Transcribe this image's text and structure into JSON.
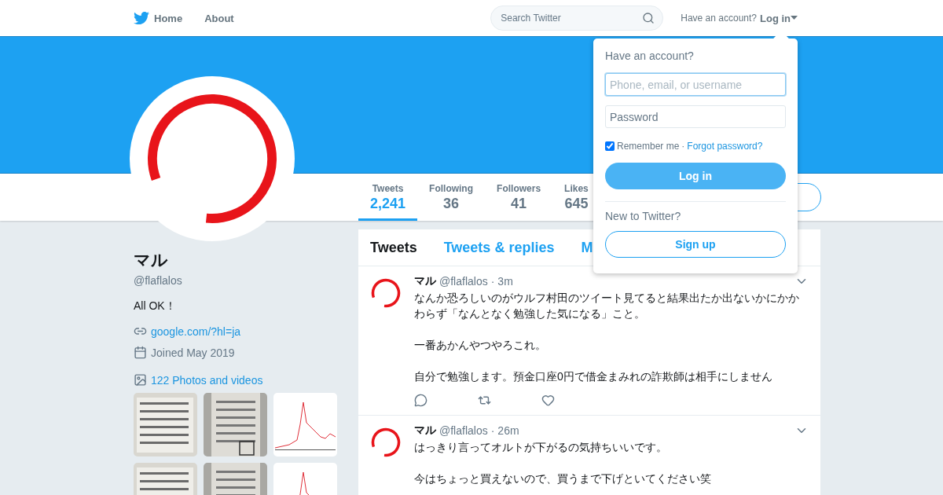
{
  "nav": {
    "items": [
      {
        "label": "Home",
        "kind": "home"
      },
      {
        "label": "About",
        "kind": "plain"
      }
    ],
    "search": {
      "placeholder": "Search Twitter"
    },
    "account_prompt": "Have an account?",
    "login_link": "Log in"
  },
  "profile": {
    "name": "マル",
    "handle": "@flaflalos",
    "bio": "All OK！",
    "url": "google.com/?hl=ja",
    "joined": "Joined May 2019",
    "photos_link": "122 Photos and videos"
  },
  "stats": [
    {
      "label": "Tweets",
      "value": "2,241",
      "selected": true
    },
    {
      "label": "Following",
      "value": "36",
      "selected": false
    },
    {
      "label": "Followers",
      "value": "41",
      "selected": false
    },
    {
      "label": "Likes",
      "value": "645",
      "selected": false
    }
  ],
  "timeline_tabs": [
    {
      "label": "Tweets",
      "selected": true
    },
    {
      "label": "Tweets & replies",
      "selected": false
    },
    {
      "label": "M",
      "selected": false
    }
  ],
  "tweets": [
    {
      "name": "マル",
      "handle": "@flaflalos",
      "separator": "·",
      "time": "3m",
      "paragraphs": [
        "なんか恐ろしいのがウルフ村田のツイート見てると結果出たか出ないかにかかわらず「なんとなく勉強した気になる」こと。",
        "一番あかんやつやろこれ。",
        "自分で勉強します。預金口座0円で借金まみれの詐欺師は相手にしません"
      ]
    },
    {
      "name": "マル",
      "handle": "@flaflalos",
      "separator": "·",
      "time": "26m",
      "paragraphs": [
        "はっきり言ってオルトが下がるの気持ちいいです。",
        "今はちょっと買えないので、買うまで下げといてください笑"
      ]
    }
  ],
  "login": {
    "title": "Have an account?",
    "username_placeholder": "Phone, email, or username",
    "password_placeholder": "Password",
    "remember_me": {
      "label": "Remember me",
      "checked": true
    },
    "separator": "·",
    "forgot": "Forgot password?",
    "submit": "Log in",
    "signup_prompt": "New to Twitter?",
    "signup": "Sign up"
  }
}
